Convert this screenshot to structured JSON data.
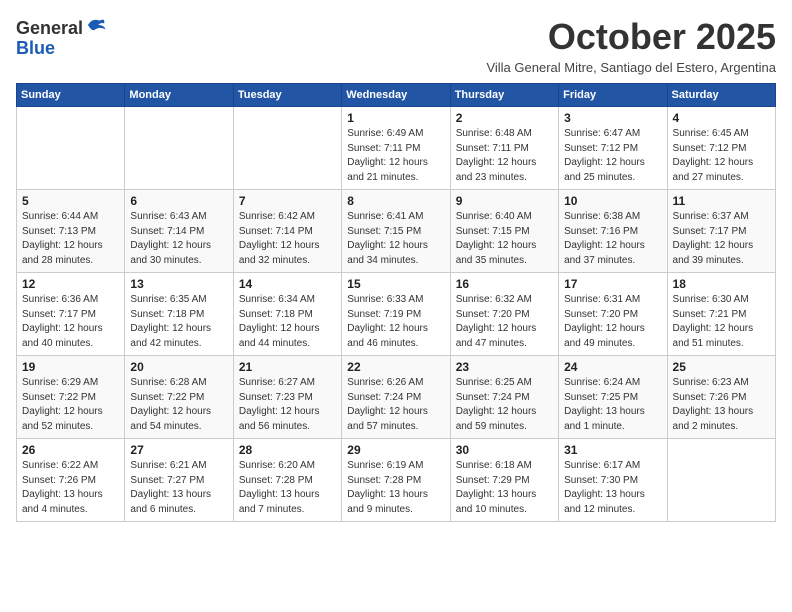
{
  "header": {
    "logo_general": "General",
    "logo_blue": "Blue",
    "month_title": "October 2025",
    "subtitle": "Villa General Mitre, Santiago del Estero, Argentina"
  },
  "weekdays": [
    "Sunday",
    "Monday",
    "Tuesday",
    "Wednesday",
    "Thursday",
    "Friday",
    "Saturday"
  ],
  "weeks": [
    [
      {
        "day": "",
        "info": ""
      },
      {
        "day": "",
        "info": ""
      },
      {
        "day": "",
        "info": ""
      },
      {
        "day": "1",
        "info": "Sunrise: 6:49 AM\nSunset: 7:11 PM\nDaylight: 12 hours\nand 21 minutes."
      },
      {
        "day": "2",
        "info": "Sunrise: 6:48 AM\nSunset: 7:11 PM\nDaylight: 12 hours\nand 23 minutes."
      },
      {
        "day": "3",
        "info": "Sunrise: 6:47 AM\nSunset: 7:12 PM\nDaylight: 12 hours\nand 25 minutes."
      },
      {
        "day": "4",
        "info": "Sunrise: 6:45 AM\nSunset: 7:12 PM\nDaylight: 12 hours\nand 27 minutes."
      }
    ],
    [
      {
        "day": "5",
        "info": "Sunrise: 6:44 AM\nSunset: 7:13 PM\nDaylight: 12 hours\nand 28 minutes."
      },
      {
        "day": "6",
        "info": "Sunrise: 6:43 AM\nSunset: 7:14 PM\nDaylight: 12 hours\nand 30 minutes."
      },
      {
        "day": "7",
        "info": "Sunrise: 6:42 AM\nSunset: 7:14 PM\nDaylight: 12 hours\nand 32 minutes."
      },
      {
        "day": "8",
        "info": "Sunrise: 6:41 AM\nSunset: 7:15 PM\nDaylight: 12 hours\nand 34 minutes."
      },
      {
        "day": "9",
        "info": "Sunrise: 6:40 AM\nSunset: 7:15 PM\nDaylight: 12 hours\nand 35 minutes."
      },
      {
        "day": "10",
        "info": "Sunrise: 6:38 AM\nSunset: 7:16 PM\nDaylight: 12 hours\nand 37 minutes."
      },
      {
        "day": "11",
        "info": "Sunrise: 6:37 AM\nSunset: 7:17 PM\nDaylight: 12 hours\nand 39 minutes."
      }
    ],
    [
      {
        "day": "12",
        "info": "Sunrise: 6:36 AM\nSunset: 7:17 PM\nDaylight: 12 hours\nand 40 minutes."
      },
      {
        "day": "13",
        "info": "Sunrise: 6:35 AM\nSunset: 7:18 PM\nDaylight: 12 hours\nand 42 minutes."
      },
      {
        "day": "14",
        "info": "Sunrise: 6:34 AM\nSunset: 7:18 PM\nDaylight: 12 hours\nand 44 minutes."
      },
      {
        "day": "15",
        "info": "Sunrise: 6:33 AM\nSunset: 7:19 PM\nDaylight: 12 hours\nand 46 minutes."
      },
      {
        "day": "16",
        "info": "Sunrise: 6:32 AM\nSunset: 7:20 PM\nDaylight: 12 hours\nand 47 minutes."
      },
      {
        "day": "17",
        "info": "Sunrise: 6:31 AM\nSunset: 7:20 PM\nDaylight: 12 hours\nand 49 minutes."
      },
      {
        "day": "18",
        "info": "Sunrise: 6:30 AM\nSunset: 7:21 PM\nDaylight: 12 hours\nand 51 minutes."
      }
    ],
    [
      {
        "day": "19",
        "info": "Sunrise: 6:29 AM\nSunset: 7:22 PM\nDaylight: 12 hours\nand 52 minutes."
      },
      {
        "day": "20",
        "info": "Sunrise: 6:28 AM\nSunset: 7:22 PM\nDaylight: 12 hours\nand 54 minutes."
      },
      {
        "day": "21",
        "info": "Sunrise: 6:27 AM\nSunset: 7:23 PM\nDaylight: 12 hours\nand 56 minutes."
      },
      {
        "day": "22",
        "info": "Sunrise: 6:26 AM\nSunset: 7:24 PM\nDaylight: 12 hours\nand 57 minutes."
      },
      {
        "day": "23",
        "info": "Sunrise: 6:25 AM\nSunset: 7:24 PM\nDaylight: 12 hours\nand 59 minutes."
      },
      {
        "day": "24",
        "info": "Sunrise: 6:24 AM\nSunset: 7:25 PM\nDaylight: 13 hours\nand 1 minute."
      },
      {
        "day": "25",
        "info": "Sunrise: 6:23 AM\nSunset: 7:26 PM\nDaylight: 13 hours\nand 2 minutes."
      }
    ],
    [
      {
        "day": "26",
        "info": "Sunrise: 6:22 AM\nSunset: 7:26 PM\nDaylight: 13 hours\nand 4 minutes."
      },
      {
        "day": "27",
        "info": "Sunrise: 6:21 AM\nSunset: 7:27 PM\nDaylight: 13 hours\nand 6 minutes."
      },
      {
        "day": "28",
        "info": "Sunrise: 6:20 AM\nSunset: 7:28 PM\nDaylight: 13 hours\nand 7 minutes."
      },
      {
        "day": "29",
        "info": "Sunrise: 6:19 AM\nSunset: 7:28 PM\nDaylight: 13 hours\nand 9 minutes."
      },
      {
        "day": "30",
        "info": "Sunrise: 6:18 AM\nSunset: 7:29 PM\nDaylight: 13 hours\nand 10 minutes."
      },
      {
        "day": "31",
        "info": "Sunrise: 6:17 AM\nSunset: 7:30 PM\nDaylight: 13 hours\nand 12 minutes."
      },
      {
        "day": "",
        "info": ""
      }
    ]
  ]
}
